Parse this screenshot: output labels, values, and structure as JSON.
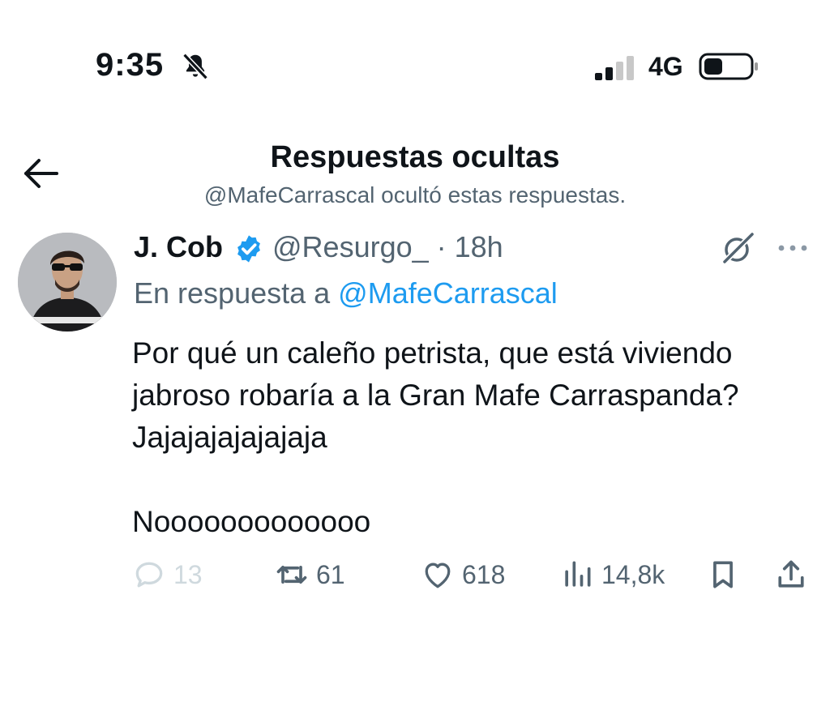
{
  "status_bar": {
    "time": "9:35",
    "network": "4G",
    "icons": [
      "bell-slash-icon",
      "signal-icon",
      "battery-icon"
    ]
  },
  "header": {
    "title": "Respuestas ocultas",
    "subtitle": "@MafeCarrascal ocultó estas respuestas.",
    "back_icon": "arrow-left-icon"
  },
  "tweet": {
    "author_name": "J. Cob",
    "handle_time": "@Resurgo_ · 18h",
    "reply_prefix": "En respuesta a",
    "reply_to": "@MafeCarrascal",
    "text": "Por qué un caleño petrista, que está viviendo jabroso robaría a la Gran Mafe Carraspanda? Jajajajajajajaja\n\nNooooooooooooo",
    "actions": {
      "replies": "13",
      "retweets": "61",
      "likes": "618",
      "views": "14,8k"
    },
    "colors": {
      "accent": "#1d9bf0",
      "secondary_text": "#536471",
      "disabled": "#cfd9de"
    }
  }
}
